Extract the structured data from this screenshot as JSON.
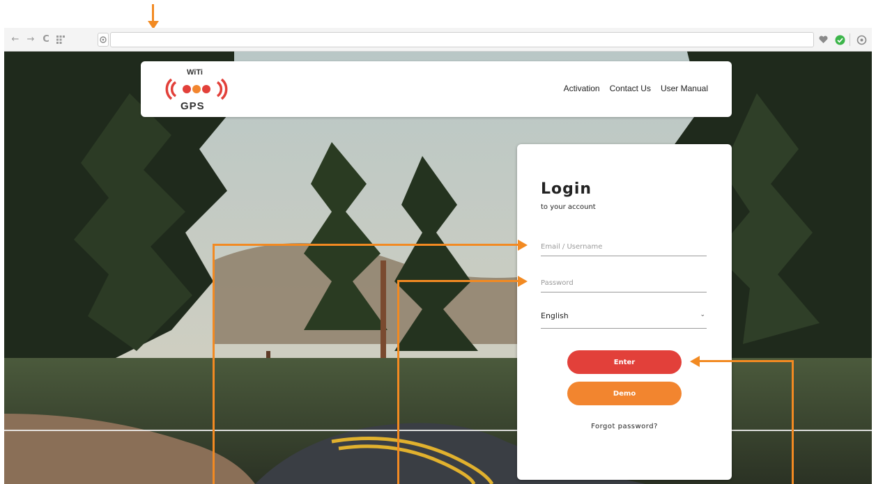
{
  "header": {
    "logo": {
      "top_text": "WiTi",
      "bottom_text": "GPS"
    },
    "nav": [
      "Activation",
      "Contact Us",
      "User Manual"
    ]
  },
  "login": {
    "title": "Login",
    "subtitle": "to your account",
    "email_placeholder": "Email / Username",
    "password_placeholder": "Password",
    "language_value": "English",
    "enter_label": "Enter",
    "demo_label": "Demo",
    "forgot_label": "Forgot password?"
  },
  "colors": {
    "accent_red": "#e2403a",
    "accent_orange": "#f2852f",
    "annotation_orange": "#f28a22"
  },
  "icons": {
    "back": "arrow-left-icon",
    "forward": "arrow-right-icon",
    "reload": "reload-icon",
    "apps": "apps-grid-icon",
    "site": "site-shield-icon",
    "bookmark": "heart-icon",
    "status": "check-circle-icon",
    "extension": "extension-icon"
  }
}
